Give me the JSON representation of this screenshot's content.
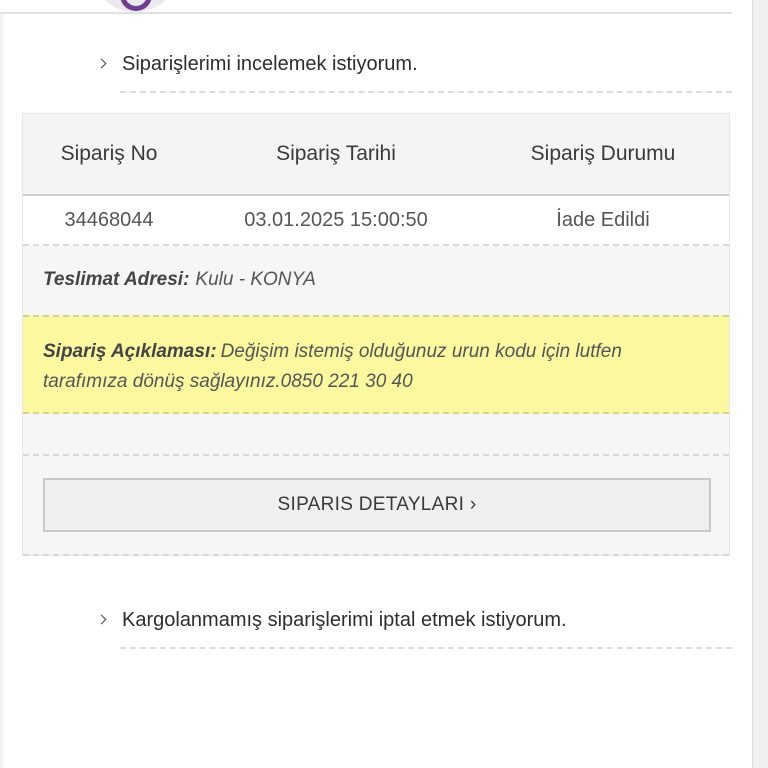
{
  "faq": {
    "item1_label": "Siparişlerimi incelemek istiyorum.",
    "item2_label": "Kargolanmamış siparişlerimi iptal etmek istiyorum."
  },
  "order": {
    "headers": {
      "order_no": "Sipariş No",
      "order_date": "Sipariş Tarihi",
      "order_status": "Sipariş Durumu"
    },
    "row": {
      "order_no": "34468044",
      "order_date": "03.01.2025 15:00:50",
      "order_status": "İade Edildi"
    },
    "address_label": "Teslimat Adresi:",
    "address_value": "Kulu - KONYA",
    "note_label": "Sipariş Açıklaması:",
    "note_value": "Değişim istemiş olduğunuz urun kodu için lutfen tarafımıza dönüş sağlayınız.0850 221 30 40",
    "details_button": "SIPARIS DETAYLARI ›"
  },
  "icons": {
    "chevron": "chevron-right-icon",
    "logo": "brand-logo"
  },
  "colors": {
    "note_background": "#fbf8a0",
    "card_background": "#f6f6f6",
    "logo_accent": "#6f3f8f"
  }
}
